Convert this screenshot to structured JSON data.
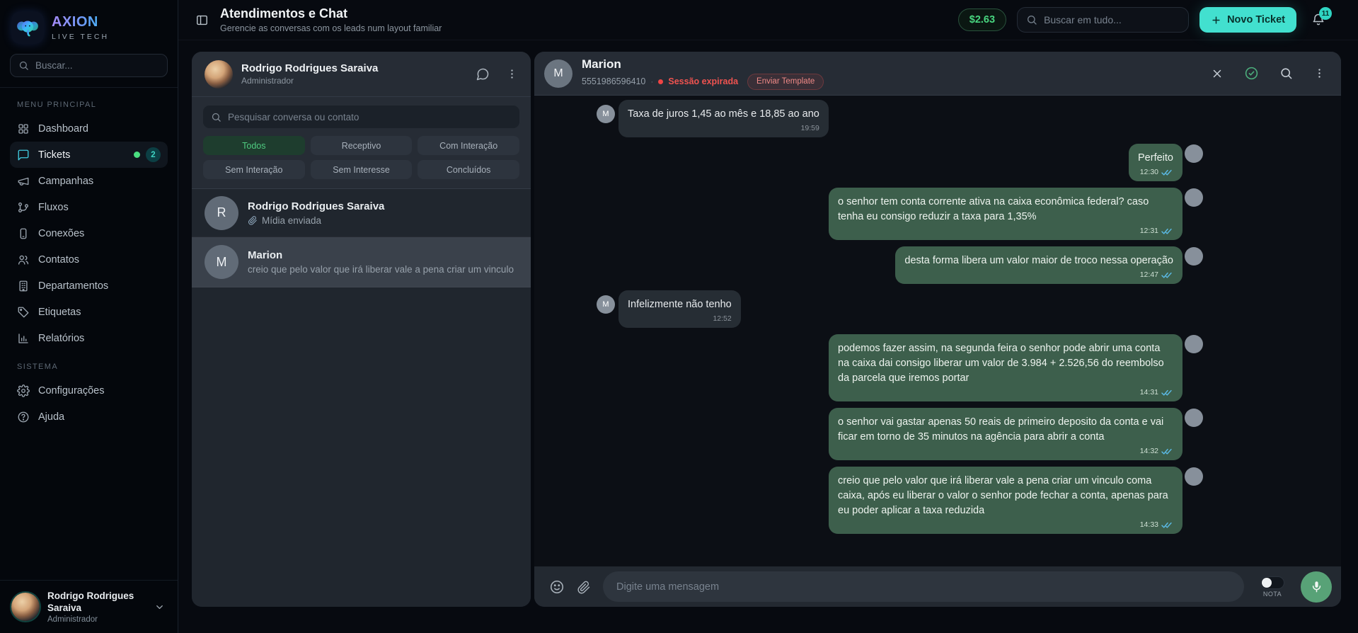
{
  "colors": {
    "accent_teal": "#42e0cf",
    "accent_green": "#4ade80",
    "outgoing_bubble_green": "#3d5f4c",
    "incoming_bubble_gray": "#262d34",
    "status_red": "#ef5350",
    "read_receipt_blue": "#5bb9e4"
  },
  "sidebar": {
    "brand": {
      "name": "AXION",
      "tagline": "LIVE TECH",
      "logo_icon": "elephant-icon"
    },
    "search_placeholder": "Buscar...",
    "sections": [
      {
        "label": "MENU PRINCIPAL",
        "items": [
          {
            "label": "Dashboard",
            "icon": "dashboard"
          },
          {
            "label": "Tickets",
            "icon": "chat",
            "active": true,
            "dot": true,
            "badge": "2"
          },
          {
            "label": "Campanhas",
            "icon": "megaphone"
          },
          {
            "label": "Fluxos",
            "icon": "flow"
          },
          {
            "label": "Conexões",
            "icon": "smartphone"
          },
          {
            "label": "Contatos",
            "icon": "users"
          },
          {
            "label": "Departamentos",
            "icon": "building"
          },
          {
            "label": "Etiquetas",
            "icon": "tag"
          },
          {
            "label": "Relatórios",
            "icon": "bar-chart"
          }
        ]
      },
      {
        "label": "SISTEMA",
        "items": [
          {
            "label": "Configurações",
            "icon": "gear"
          },
          {
            "label": "Ajuda",
            "icon": "help-circle"
          }
        ]
      }
    ],
    "user": {
      "name": "Rodrigo Rodrigues Saraiva",
      "role": "Administrador"
    }
  },
  "header": {
    "title": "Atendimentos e Chat",
    "subtitle": "Gerencie as conversas com os leads num layout familiar",
    "balance": "$2.63",
    "search_placeholder": "Buscar em tudo...",
    "new_ticket_label": "Novo Ticket",
    "notifications_count": "11"
  },
  "conversations": {
    "agent": {
      "name": "Rodrigo Rodrigues Saraiva",
      "role": "Administrador"
    },
    "search_placeholder": "Pesquisar conversa ou contato",
    "filters": [
      {
        "label": "Todos",
        "active": true
      },
      {
        "label": "Receptivo"
      },
      {
        "label": "Com Interação"
      },
      {
        "label": "Sem Interação"
      },
      {
        "label": "Sem Interesse"
      },
      {
        "label": "Concluídos"
      }
    ],
    "items": [
      {
        "initial": "R",
        "name": "Rodrigo Rodrigues Saraiva",
        "preview": "Mídia enviada",
        "has_attachment": true,
        "selected": false
      },
      {
        "initial": "M",
        "name": "Marion",
        "preview": "creio que pelo valor que irá liberar vale a pena criar um vinculo",
        "has_attachment": false,
        "selected": true
      }
    ]
  },
  "chat": {
    "contact": {
      "initial": "M",
      "name": "Marion",
      "phone": "5551986596410",
      "status": "Sessão expirada",
      "template_button": "Enviar Template"
    },
    "messages": [
      {
        "direction": "in",
        "text": "Taxa de juros 1,45 ao mês e 18,85 ao ano",
        "time": "19:59"
      },
      {
        "direction": "out",
        "text": "Perfeito",
        "time": "12:30"
      },
      {
        "direction": "out",
        "text": "o senhor tem conta corrente ativa na caixa econômica federal? caso tenha eu consigo reduzir a taxa para 1,35%",
        "time": "12:31"
      },
      {
        "direction": "out",
        "text": "desta forma libera um valor maior de troco nessa operação",
        "time": "12:47"
      },
      {
        "direction": "in",
        "text": "Infelizmente não tenho",
        "time": "12:52"
      },
      {
        "direction": "out",
        "text": "podemos fazer assim, na segunda feira o senhor pode abrir uma conta na caixa dai consigo liberar um valor de  3.984 + 2.526,56 do reembolso da parcela que iremos portar",
        "time": "14:31"
      },
      {
        "direction": "out",
        "text": "o senhor vai gastar apenas 50 reais de primeiro deposito da conta e vai ficar em torno de 35 minutos na agência para abrir a conta",
        "time": "14:32"
      },
      {
        "direction": "out",
        "text": "creio que pelo valor que irá liberar vale a pena criar um vinculo coma caixa, após eu liberar o valor o senhor pode fechar a conta, apenas para eu poder aplicar a taxa reduzida",
        "time": "14:33"
      }
    ],
    "composer": {
      "placeholder": "Digite uma mensagem",
      "note_label": "NOTA"
    }
  }
}
